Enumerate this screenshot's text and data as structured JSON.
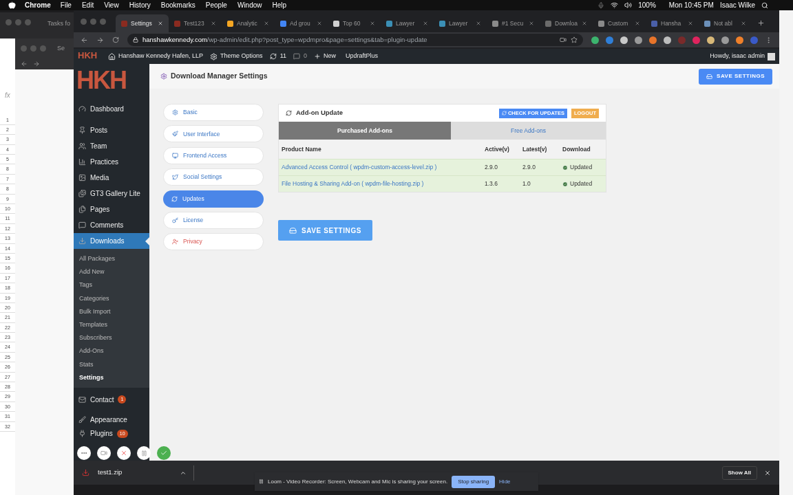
{
  "menu_bar": {
    "app": "Chrome",
    "menus": [
      "File",
      "Edit",
      "View",
      "History",
      "Bookmarks",
      "People",
      "Window",
      "Help"
    ],
    "battery": "100%",
    "clock": "Mon 10:45 PM",
    "user": "Isaac Wilke"
  },
  "back_windows": {
    "tab_1": "Tasks fo",
    "tab_2": "Se",
    "formula_label": "fx",
    "sheet_rows": [
      "1",
      "2",
      "3",
      "4",
      "5",
      "8",
      "7",
      "8",
      "9",
      "10",
      "11",
      "12",
      "13",
      "14",
      "15",
      "16",
      "17",
      "18",
      "19",
      "20",
      "21",
      "22",
      "23",
      "24",
      "25",
      "26",
      "27",
      "28",
      "29",
      "30",
      "31",
      "32"
    ]
  },
  "browser": {
    "tabs": [
      {
        "label": "Settings",
        "selected": true,
        "color": "#8b2b20"
      },
      {
        "label": "Test123",
        "selected": false,
        "color": "#8b2b20"
      },
      {
        "label": "Analytic",
        "selected": false,
        "color": "#f4a623"
      },
      {
        "label": "Ad grou",
        "selected": false,
        "color": "#4285f4"
      },
      {
        "label": "Top 60",
        "selected": false,
        "color": "#d0d0d0"
      },
      {
        "label": "Lawyer",
        "selected": false,
        "color": "#3b8fb5"
      },
      {
        "label": "Lawyer",
        "selected": false,
        "color": "#3b8fb5"
      },
      {
        "label": "#1 Secu",
        "selected": false,
        "color": "#8a8a8a"
      },
      {
        "label": "Downloa",
        "selected": false,
        "color": "#6b6b6b"
      },
      {
        "label": "Custom",
        "selected": false,
        "color": "#8a8a8a"
      },
      {
        "label": "Hansha",
        "selected": false,
        "color": "#4a5fa8"
      },
      {
        "label": "Not abl",
        "selected": false,
        "color": "#6b8fb8"
      }
    ],
    "url_host": "hanshawkennedy.com",
    "url_path": "/wp-admin/edit.php?post_type=wpdmpro&page=settings&tab=plugin-update",
    "extensions": [
      {
        "color": "#3cb46e"
      },
      {
        "color": "#2f7fd8"
      },
      {
        "color": "#c8c8c8"
      },
      {
        "color": "#9a9a9a"
      },
      {
        "color": "#e8742a"
      },
      {
        "color": "#bdbdbd"
      },
      {
        "color": "#7a2a2a"
      },
      {
        "color": "#e0245e"
      },
      {
        "color": "#d8b878"
      },
      {
        "color": "#9a9a9a"
      },
      {
        "color": "#f0802a"
      },
      {
        "color": "#3a5ac8"
      }
    ]
  },
  "admin_bar": {
    "logo": "HKH",
    "site": "Hanshaw Kennedy Hafen, LLP",
    "theme_options": "Theme Options",
    "updates": "11",
    "comments": "0",
    "new": "New",
    "plugin": "UpdraftPlus",
    "greeting": "Howdy, isaac admin"
  },
  "sidebar": {
    "logo": "HKH",
    "items": [
      {
        "label": "Dashboard",
        "kind": "dashboard",
        "selected": false
      },
      {
        "label": "Posts",
        "kind": "posts",
        "selected": false
      },
      {
        "label": "Team",
        "kind": "team",
        "selected": false
      },
      {
        "label": "Practices",
        "kind": "practices",
        "selected": false
      },
      {
        "label": "Media",
        "kind": "media",
        "selected": false
      },
      {
        "label": "GT3 Gallery Lite",
        "kind": "gallery",
        "selected": false
      },
      {
        "label": "Pages",
        "kind": "pages",
        "selected": false
      },
      {
        "label": "Comments",
        "kind": "comments",
        "selected": false
      },
      {
        "label": "Downloads",
        "kind": "downloads",
        "selected": true,
        "children": [
          {
            "label": "All Packages",
            "selected": false
          },
          {
            "label": "Add New",
            "selected": false
          },
          {
            "label": "Tags",
            "selected": false
          },
          {
            "label": "Categories",
            "selected": false
          },
          {
            "label": "Bulk Import",
            "selected": false
          },
          {
            "label": "Templates",
            "selected": false
          },
          {
            "label": "Subscribers",
            "selected": false
          },
          {
            "label": "Add-Ons",
            "selected": false
          },
          {
            "label": "Stats",
            "selected": false
          },
          {
            "label": "Settings",
            "selected": true
          }
        ]
      },
      {
        "label": "Contact",
        "kind": "contact",
        "selected": false,
        "badge": "1"
      },
      {
        "label": "Appearance",
        "kind": "appearance",
        "selected": false
      },
      {
        "label": "Plugins",
        "kind": "plugins",
        "selected": false,
        "badge": "10"
      }
    ]
  },
  "page": {
    "title": "Download Manager Settings",
    "save_top": "SAVE SETTINGS",
    "nav": [
      {
        "label": "Basic",
        "kind": "gear",
        "selected": false
      },
      {
        "label": "User Interface",
        "kind": "paint",
        "selected": false
      },
      {
        "label": "Frontend Access",
        "kind": "monitor",
        "selected": false
      },
      {
        "label": "Social Settings",
        "kind": "twitter",
        "selected": false
      },
      {
        "label": "Updates",
        "kind": "refresh",
        "selected": true
      },
      {
        "label": "License",
        "kind": "key",
        "selected": false
      },
      {
        "label": "Privacy",
        "kind": "privacy",
        "selected": false
      }
    ],
    "panel": {
      "title": "Add-on Update",
      "check_button": "CHECK FOR UPDATES",
      "logout_button": "LOGOUT",
      "tabs": [
        {
          "label": "Purchased Add-ons",
          "selected": true
        },
        {
          "label": "Free Add-ons",
          "selected": false
        }
      ],
      "columns": [
        "Product Name",
        "Active(v)",
        "Latest(v)",
        "Download"
      ],
      "rows": [
        {
          "name": "Advanced Access Control ( wpdm-custom-access-level.zip )",
          "active": "2.9.0",
          "latest": "2.9.0",
          "status": "Updated"
        },
        {
          "name": "File Hosting & Sharing Add-on ( wpdm-file-hosting.zip )",
          "active": "1.3.6",
          "latest": "1.0",
          "status": "Updated"
        }
      ]
    },
    "save_bottom": "SAVE SETTINGS"
  },
  "download_shelf": {
    "file": "test1.zip",
    "show_all": "Show All"
  },
  "loom_bar": {
    "message": "Loom - Video Recorder: Screen, Webcam and Mic is sharing your screen.",
    "stop": "Stop sharing",
    "hide": "Hide"
  }
}
